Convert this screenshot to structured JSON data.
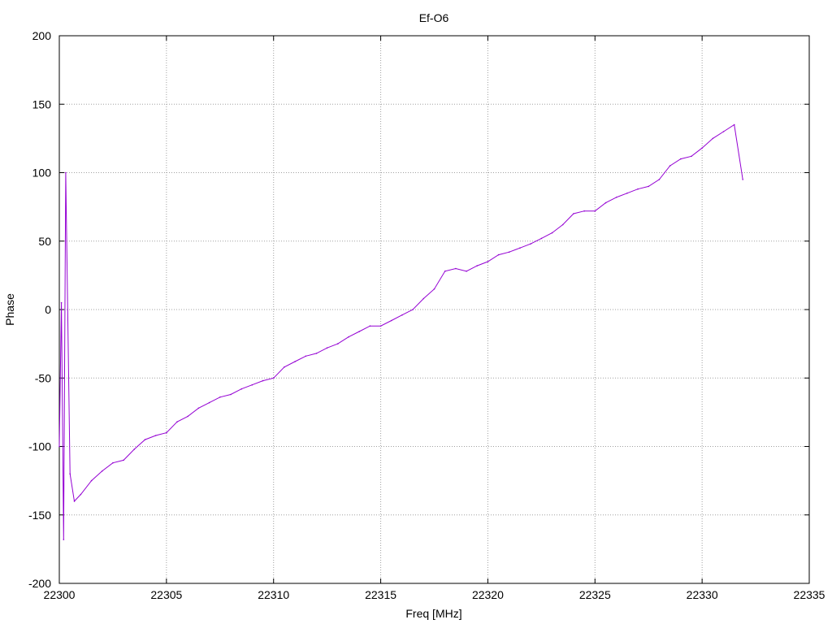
{
  "chart_data": {
    "type": "line",
    "title": "Ef-O6",
    "xlabel": "Freq [MHz]",
    "ylabel": "Phase",
    "xlim": [
      22300,
      22335
    ],
    "ylim": [
      -200,
      200
    ],
    "x_ticks": [
      22300,
      22305,
      22310,
      22315,
      22320,
      22325,
      22330,
      22335
    ],
    "y_ticks": [
      -200,
      -150,
      -100,
      -50,
      0,
      50,
      100,
      150,
      200
    ],
    "grid": true,
    "series": [
      {
        "color": "#9400d3",
        "x": [
          22300.0,
          22300.1,
          22300.2,
          22300.3,
          22300.5,
          22300.7,
          22301.0,
          22301.5,
          22302.0,
          22302.5,
          22303.0,
          22303.5,
          22304.0,
          22304.5,
          22305.0,
          22305.5,
          22306.0,
          22306.5,
          22307.0,
          22307.5,
          22308.0,
          22308.5,
          22309.0,
          22309.5,
          22310.0,
          22310.5,
          22311.0,
          22311.5,
          22312.0,
          22312.5,
          22313.0,
          22313.5,
          22314.0,
          22314.5,
          22315.0,
          22315.5,
          22316.0,
          22316.5,
          22317.0,
          22317.5,
          22318.0,
          22318.5,
          22319.0,
          22319.5,
          22320.0,
          22320.5,
          22321.0,
          22321.5,
          22322.0,
          22322.5,
          22323.0,
          22323.5,
          22324.0,
          22324.5,
          22325.0,
          22325.5,
          22326.0,
          22326.5,
          22327.0,
          22327.5,
          22328.0,
          22328.5,
          22329.0,
          22329.5,
          22330.0,
          22330.5,
          22331.0,
          22331.5,
          22331.9
        ],
        "values": [
          -100,
          5,
          -168,
          100,
          -120,
          -140,
          -135,
          -125,
          -118,
          -112,
          -110,
          -102,
          -95,
          -92,
          -90,
          -82,
          -78,
          -72,
          -68,
          -64,
          -62,
          -58,
          -55,
          -52,
          -50,
          -42,
          -38,
          -34,
          -32,
          -28,
          -25,
          -20,
          -16,
          -12,
          -12,
          -8,
          -4,
          0,
          8,
          15,
          28,
          30,
          28,
          32,
          35,
          40,
          42,
          45,
          48,
          52,
          56,
          62,
          70,
          72,
          72,
          78,
          82,
          85,
          88,
          90,
          95,
          105,
          110,
          112,
          118,
          125,
          130,
          135,
          95
        ]
      }
    ]
  }
}
